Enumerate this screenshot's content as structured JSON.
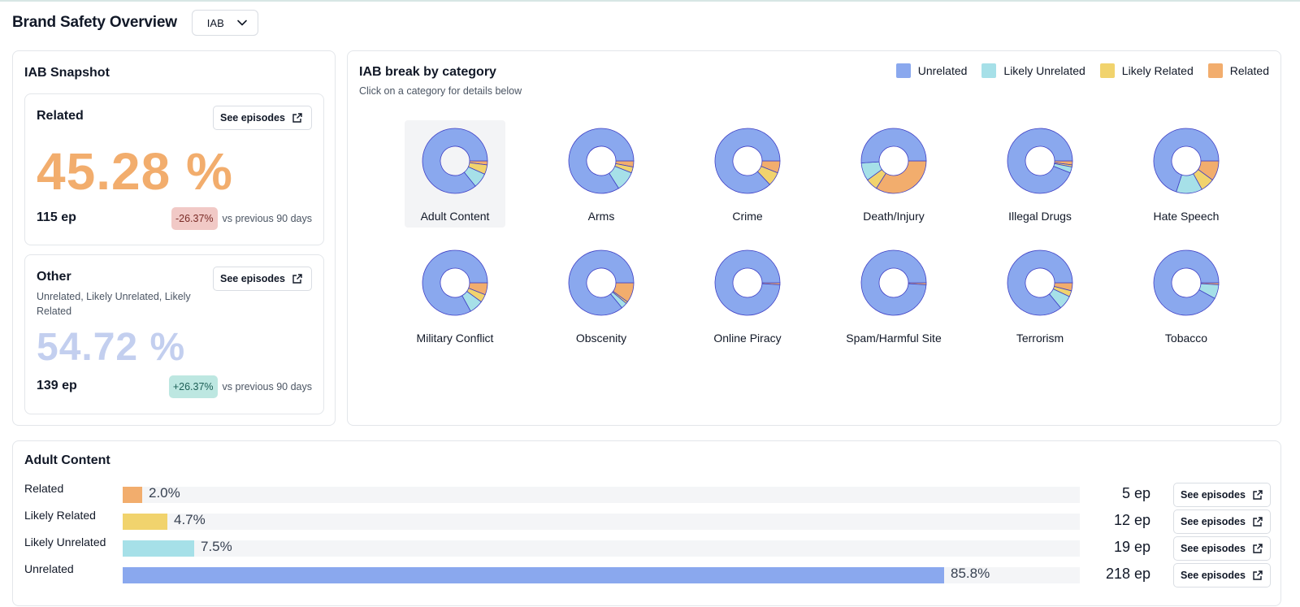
{
  "header": {
    "title": "Brand Safety Overview",
    "dropdown_value": "IAB"
  },
  "colors": {
    "unrelated": "#8aa8ee",
    "likely_unrelated": "#a6e0e8",
    "likely_related": "#f1d36d",
    "related": "#f2ad6d",
    "stroke": "#3f3fc4"
  },
  "snapshot": {
    "title": "IAB Snapshot",
    "related": {
      "title": "Related",
      "button": "See episodes",
      "percent": "45.28 %",
      "episodes": "115 ep",
      "delta": "-26.37%",
      "comparison": "vs previous 90 days"
    },
    "other": {
      "title": "Other",
      "note": "Unrelated, Likely Unrelated, Likely Related",
      "button": "See episodes",
      "percent": "54.72 %",
      "episodes": "139 ep",
      "delta": "+26.37%",
      "comparison": "vs previous 90 days"
    }
  },
  "breakdown": {
    "title": "IAB break by category",
    "subtitle": "Click on a category for details below",
    "legend": [
      "Unrelated",
      "Likely Unrelated",
      "Likely Related",
      "Related"
    ]
  },
  "chart_data": {
    "type": "pie",
    "series_order": [
      "Unrelated",
      "Likely Unrelated",
      "Likely Related",
      "Related"
    ],
    "categories": [
      {
        "name": "Adult Content",
        "values": [
          85.8,
          7.5,
          4.7,
          2.0
        ],
        "selected": true
      },
      {
        "name": "Arms",
        "values": [
          84,
          10,
          3,
          3
        ]
      },
      {
        "name": "Crime",
        "values": [
          87,
          0,
          7,
          6
        ]
      },
      {
        "name": "Death/Injury",
        "values": [
          51,
          9,
          6,
          34
        ]
      },
      {
        "name": "Illegal Drugs",
        "values": [
          94,
          3,
          1,
          2
        ]
      },
      {
        "name": "Hate Speech",
        "values": [
          70,
          13,
          7,
          10
        ]
      },
      {
        "name": "Military Conflict",
        "values": [
          83,
          7,
          4,
          6
        ]
      },
      {
        "name": "Obscenity",
        "values": [
          86,
          3,
          1,
          10
        ]
      },
      {
        "name": "Online Piracy",
        "values": [
          99,
          0,
          0,
          1
        ]
      },
      {
        "name": "Spam/Harmful Site",
        "values": [
          99,
          0,
          0,
          1
        ]
      },
      {
        "name": "Terrorism",
        "values": [
          86,
          7,
          3,
          4
        ]
      },
      {
        "name": "Tobacco",
        "values": [
          92,
          7,
          0,
          1
        ]
      }
    ]
  },
  "details": {
    "title": "Adult Content",
    "rows": [
      {
        "label": "Related",
        "percent": "2.0%",
        "value": 2.0,
        "episodes": "5 ep",
        "button": "See episodes",
        "color": "#f2ad6d"
      },
      {
        "label": "Likely Related",
        "percent": "4.7%",
        "value": 4.7,
        "episodes": "12 ep",
        "button": "See episodes",
        "color": "#f1d36d"
      },
      {
        "label": "Likely Unrelated",
        "percent": "7.5%",
        "value": 7.5,
        "episodes": "19 ep",
        "button": "See episodes",
        "color": "#a6e0e8"
      },
      {
        "label": "Unrelated",
        "percent": "85.8%",
        "value": 85.8,
        "episodes": "218 ep",
        "button": "See episodes",
        "color": "#8aa8ee"
      }
    ]
  }
}
